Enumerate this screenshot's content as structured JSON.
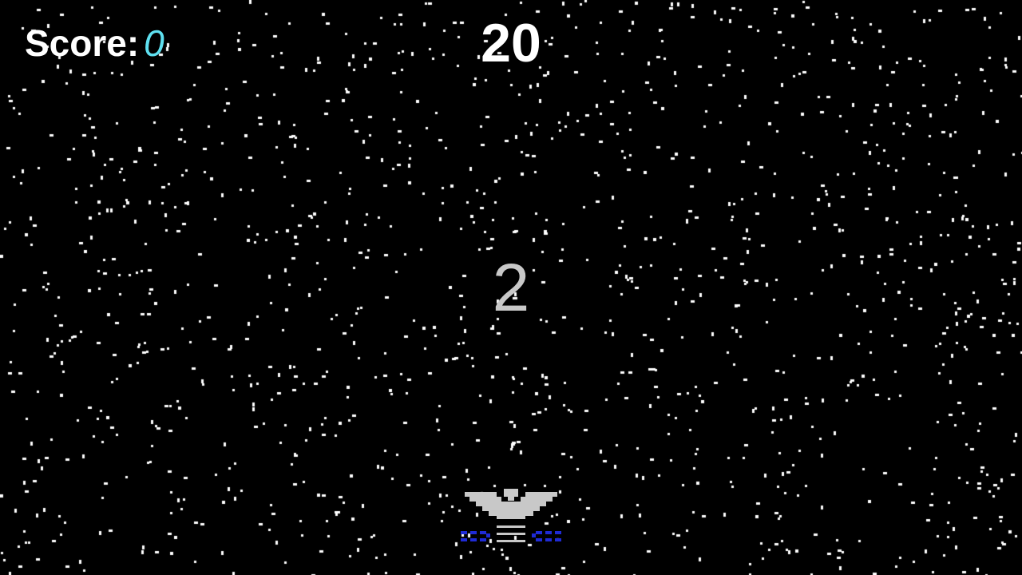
{
  "hud": {
    "score_label": "Score:",
    "score_value": "0",
    "timer": "20"
  },
  "countdown": "2",
  "player": {
    "sprite": "spaceship-icon",
    "body_color": "#c8c8c8",
    "thruster_color": "#1f2bd6"
  },
  "colors": {
    "background": "#000000",
    "star": "#ffffff",
    "score_value": "#5ee0f0",
    "countdown": "#c8c8c8"
  }
}
